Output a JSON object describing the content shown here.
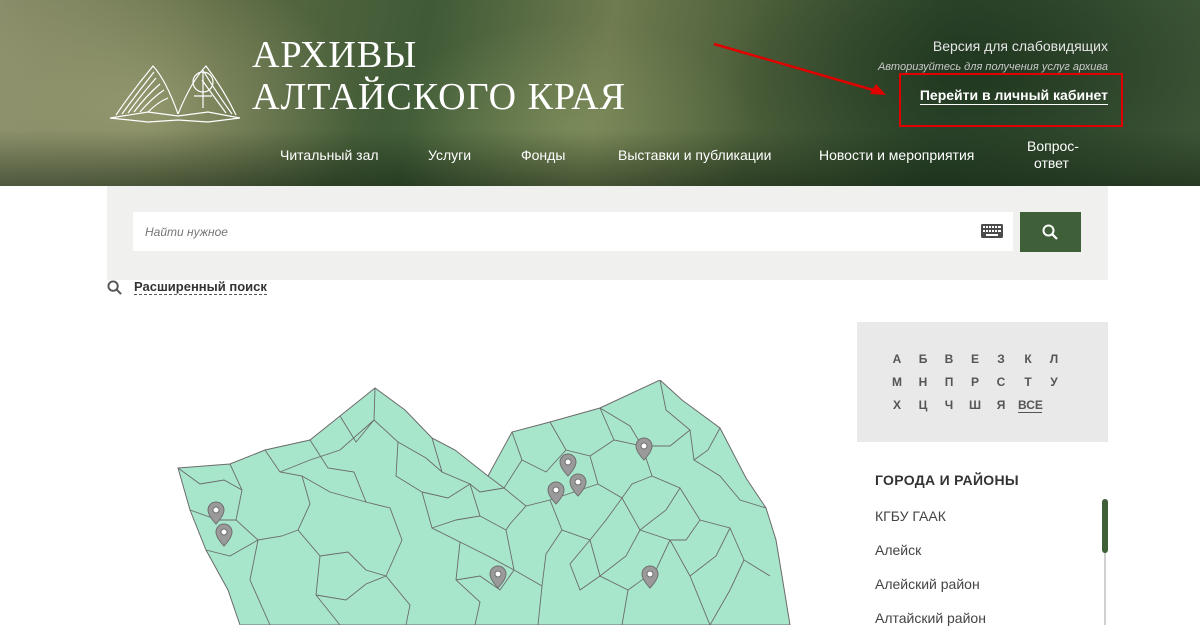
{
  "header": {
    "title_line1": "АРХИВЫ",
    "title_line2": "АЛТАЙСКОГО КРАЯ",
    "low_vision_label": "Версия для слабовидящих",
    "auth_hint": "Авторизуйтесь для получения услуг архива",
    "cabinet_link": "Перейти в личный кабинет",
    "highlight_color": "#e00000"
  },
  "nav": {
    "items": [
      {
        "label": "Читальный зал"
      },
      {
        "label": "Услуги"
      },
      {
        "label": "Фонды"
      },
      {
        "label": "Выставки и публикации"
      },
      {
        "label": "Новости и мероприятия"
      },
      {
        "label": "Вопрос-"
      },
      {
        "label": "ответ"
      }
    ]
  },
  "search": {
    "placeholder": "Найти нужное",
    "keyboard_icon": "keyboard-icon",
    "button_icon": "search-icon",
    "advanced_label": "Расширенный поиск",
    "accent": "#3e5f38"
  },
  "alphabet": {
    "letters": [
      "А",
      "Б",
      "В",
      "Е",
      "З",
      "К",
      "Л",
      "М",
      "Н",
      "П",
      "Р",
      "С",
      "Т",
      "У",
      "Х",
      "Ц",
      "Ч",
      "Ш",
      "Я",
      "ВСЕ"
    ]
  },
  "cities": {
    "title": "ГОРОДА И РАЙОНЫ",
    "items": [
      "КГБУ ГААК",
      "Алейск",
      "Алейский район",
      "Алтайский район"
    ]
  },
  "map": {
    "fill_color": "#a8e6cc",
    "border_color": "#6b6b6b",
    "pin_color": "#9a9a9a"
  }
}
